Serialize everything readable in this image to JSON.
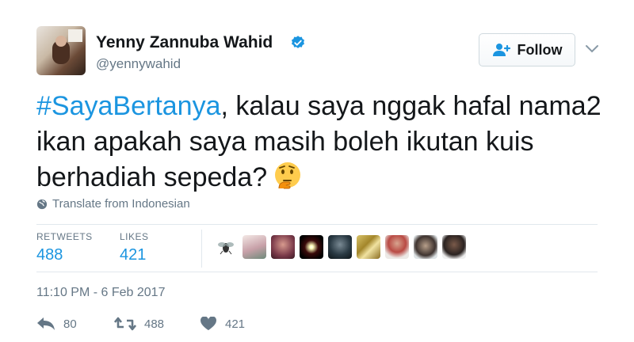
{
  "author": {
    "name": "Yenny Zannuba Wahid",
    "handle": "@yennywahid",
    "verified": true
  },
  "follow_button": {
    "label": "Follow",
    "icon": "add-user-icon"
  },
  "tweet": {
    "hashtag": "#SayaBertanya",
    "line1_rest": ", kalau saya nggak hafal nama2",
    "line2": "ikan apakah saya masih boleh ikutan kuis",
    "line3": "berhadiah sepeda?",
    "emoji": "thinking-face-emoji"
  },
  "translate": {
    "label": "Translate from Indonesian",
    "icon": "globe-icon"
  },
  "stats": {
    "retweets_label": "RETWEETS",
    "retweets_value": "488",
    "likes_label": "LIKES",
    "likes_value": "421"
  },
  "likers_count_shown": 9,
  "timestamp": "11:10 PM - 6 Feb 2017",
  "actions": {
    "reply_count": "80",
    "retweet_count": "488",
    "like_count": "421"
  },
  "colors": {
    "link_blue": "#1b95e0",
    "text": "#14171a",
    "muted": "#657786",
    "border": "#e1e8ed"
  }
}
